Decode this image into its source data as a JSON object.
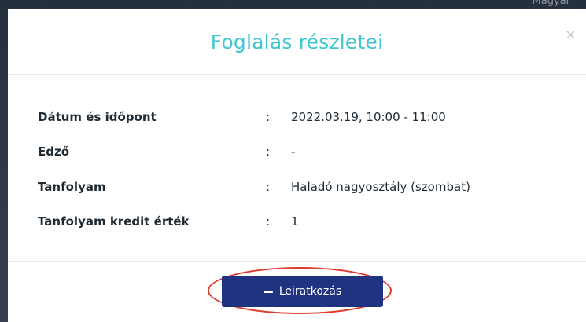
{
  "backdrop": {
    "partial_text": "Magyar"
  },
  "modal": {
    "title": "Foglalás részletei",
    "close_symbol": "×",
    "details": [
      {
        "label": "Dátum és időpont",
        "separator": ":",
        "value": "2022.03.19, 10:00 - 11:00"
      },
      {
        "label": "Edző",
        "separator": ":",
        "value": "-"
      },
      {
        "label": "Tanfolyam",
        "separator": ":",
        "value": "Haladó nagyosztály (szombat)"
      },
      {
        "label": "Tanfolyam kredit érték",
        "separator": ":",
        "value": "1"
      }
    ],
    "footer": {
      "unsubscribe_label": "Leiratkozás",
      "unsubscribe_icon": "minus-icon"
    }
  },
  "colors": {
    "title": "#3fc7cf",
    "button_bg": "#1f3380",
    "highlight": "#e0392e"
  }
}
